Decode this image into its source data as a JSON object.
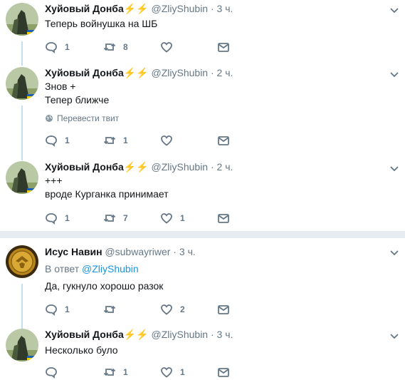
{
  "tweets": [
    {
      "name": "Хуйовый Донба",
      "emoji": "⚡⚡",
      "handle": "@ZliyShubin",
      "time": "3 ч.",
      "lines": [
        "Теперь войнушка на ШБ"
      ],
      "replies": "1",
      "retweets": "8",
      "likes": ""
    },
    {
      "name": "Хуйовый Донба",
      "emoji": "⚡⚡",
      "handle": "@ZliyShubin",
      "time": "2 ч.",
      "lines": [
        "Знов +",
        "Тепер ближче"
      ],
      "translate": "Перевести твит",
      "replies": "1",
      "retweets": "1",
      "likes": ""
    },
    {
      "name": "Хуйовый Донба",
      "emoji": "⚡⚡",
      "handle": "@ZliyShubin",
      "time": "2 ч.",
      "lines": [
        "+++",
        "вроде Курганка принимает"
      ],
      "replies": "1",
      "retweets": "7",
      "likes": "1"
    },
    {
      "name": "Исус Навин",
      "emoji": "",
      "handle": "@subwayriwer",
      "time": "3 ч.",
      "reply_prefix": "В ответ",
      "reply_to": "@ZliyShubin",
      "lines": [
        "Да, гукнуло хорошо разок"
      ],
      "replies": "1",
      "retweets": "",
      "likes": "2"
    },
    {
      "name": "Хуйовый Донба",
      "emoji": "⚡⚡",
      "handle": "@ZliyShubin",
      "time": "3 ч.",
      "lines": [
        "Несколько було"
      ],
      "replies": "",
      "retweets": "1",
      "likes": "1"
    }
  ],
  "separator": "·",
  "icons": {
    "reply": "reply-icon",
    "retweet": "retweet-icon",
    "like": "heart-icon",
    "dm": "envelope-icon",
    "more": "chevron-down-icon",
    "translate": "globe-icon"
  },
  "colors": {
    "link": "#1b95e0",
    "muted": "#657786",
    "thread_line": "#c4dfef",
    "divider": "#e6ecf0",
    "bolt": "#f6b10e"
  }
}
